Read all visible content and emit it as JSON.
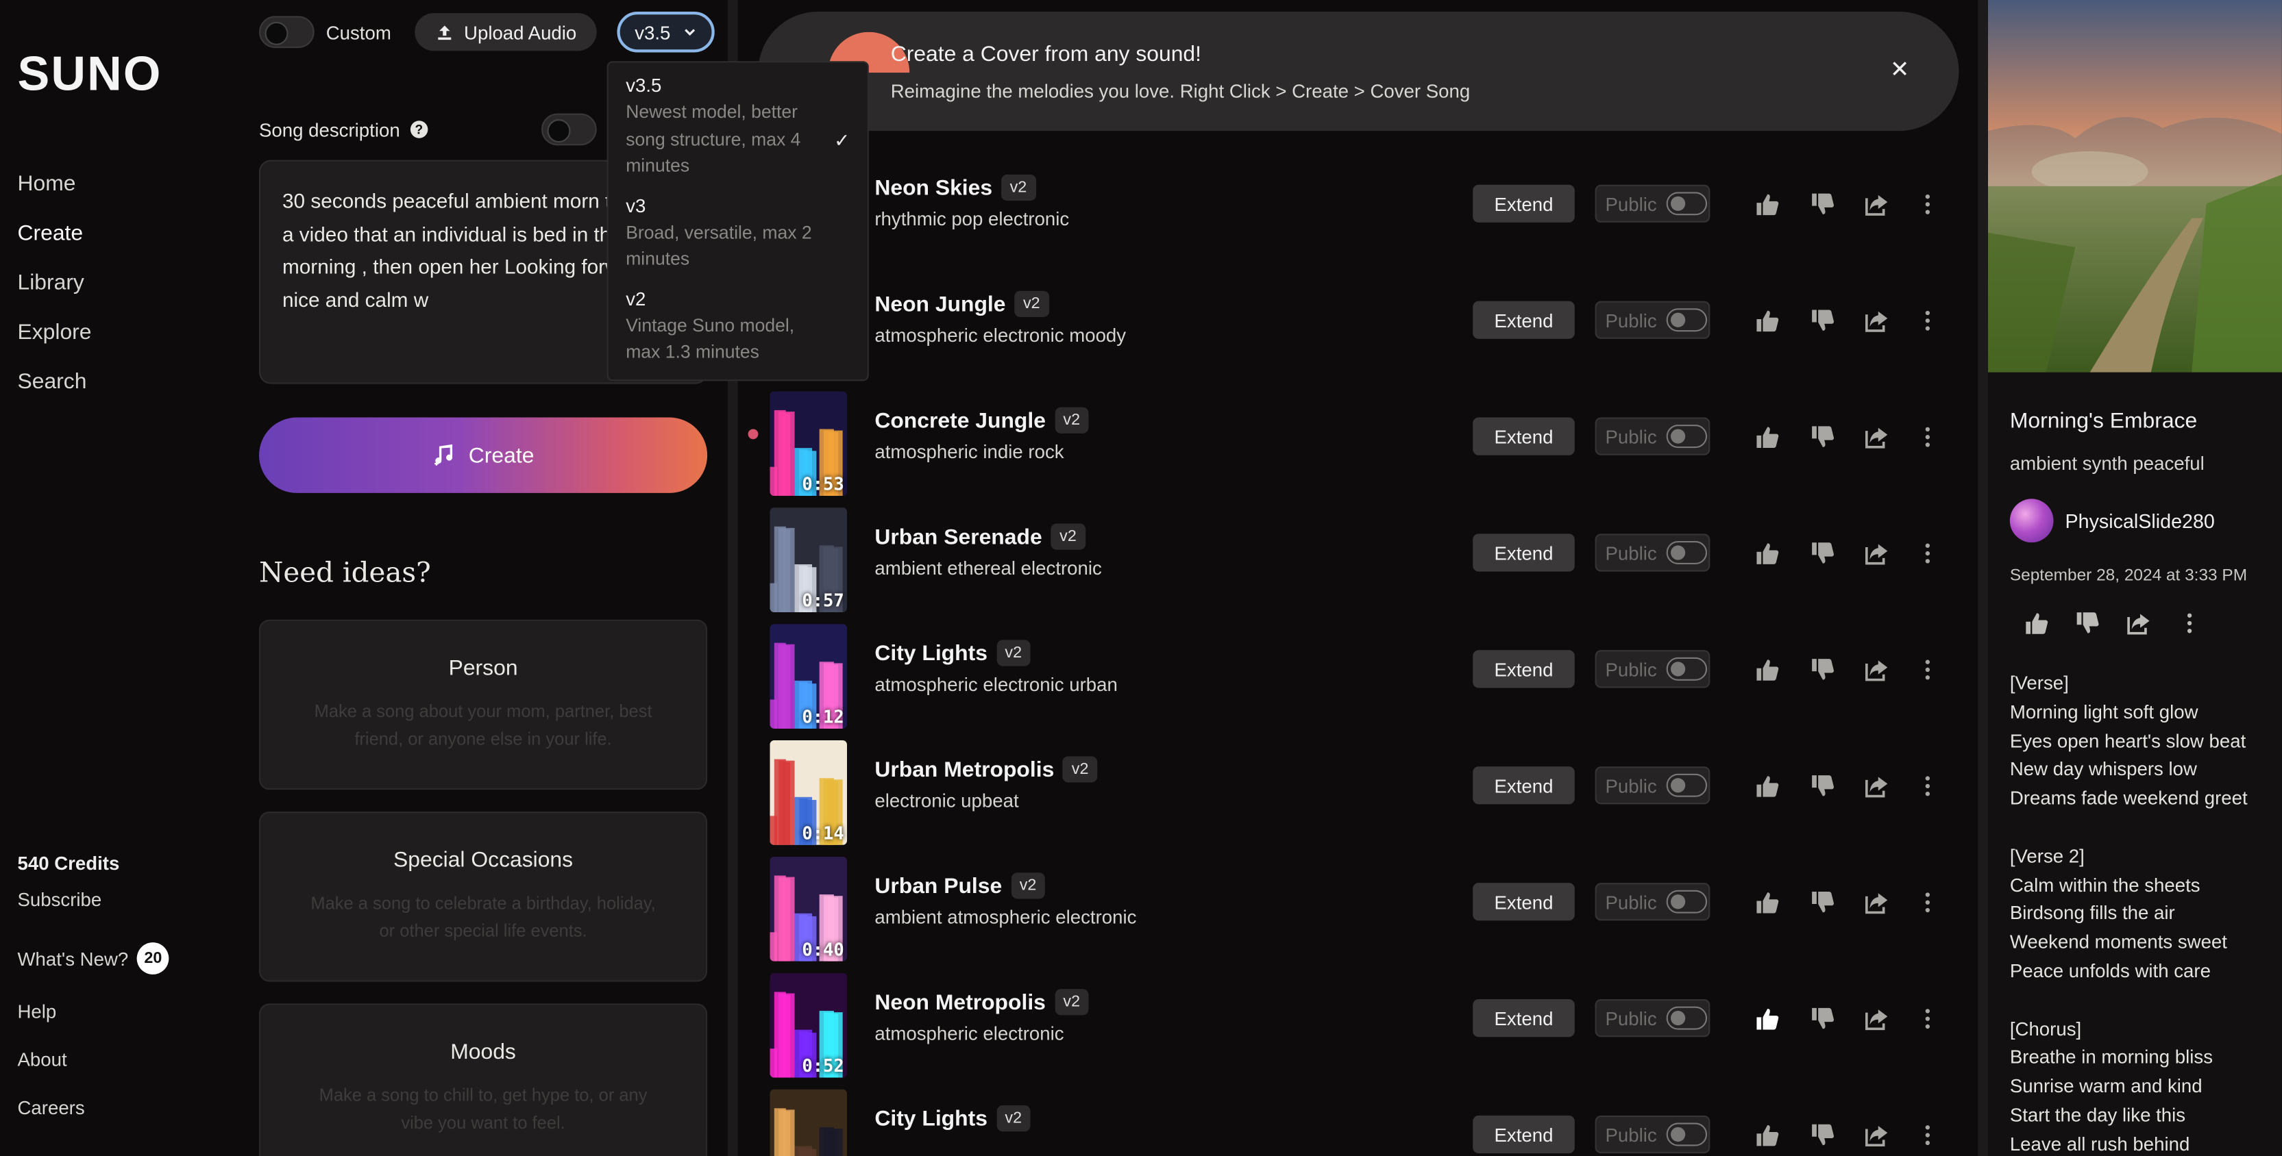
{
  "sidebar": {
    "logo": "SUNO",
    "nav": [
      "Home",
      "Create",
      "Library",
      "Explore",
      "Search"
    ],
    "credits": "540 Credits",
    "subscribe": "Subscribe",
    "whats_new": "What's New?",
    "whats_new_count": "20",
    "links": [
      "Help",
      "About",
      "Careers"
    ]
  },
  "create": {
    "custom_label": "Custom",
    "upload_label": "Upload Audio",
    "version": "v3.5",
    "desc_label": "Song description",
    "desc_text": "30 seconds peaceful ambient morn track for a video that an individual is bed in the morning , then open her Looking forward a  nice and calm w",
    "create_label": "Create",
    "ideas_title": "Need ideas?",
    "ideas": [
      {
        "title": "Person",
        "text": "Make a song about your mom, partner, best friend, or anyone else in your life."
      },
      {
        "title": "Special Occasions",
        "text": "Make a song to celebrate a birthday, holiday, or other special life events."
      },
      {
        "title": "Moods",
        "text": "Make a song to chill to, get hype to, or any vibe you want to feel."
      }
    ]
  },
  "dropdown": [
    {
      "title": "v3.5",
      "desc": "Newest model, better song structure, max 4 minutes",
      "selected": true
    },
    {
      "title": "v3",
      "desc": "Broad, versatile, max 2 minutes",
      "selected": false
    },
    {
      "title": "v2",
      "desc": "Vintage Suno model, max 1.3 minutes",
      "selected": false
    }
  ],
  "banner": {
    "title": "Create a Cover from any sound!",
    "subtitle": "Reimagine the melodies you love. Right Click > Create > Cover Song"
  },
  "labels": {
    "extend": "Extend",
    "public": "Public"
  },
  "songs": [
    {
      "title": "Neon Skies",
      "tag": "v2",
      "style": "rhythmic pop electronic",
      "duration": "",
      "liked": false
    },
    {
      "title": "Neon Jungle",
      "tag": "v2",
      "style": "atmospheric electronic moody",
      "duration": "",
      "liked": false
    },
    {
      "title": "Concrete Jungle",
      "tag": "v2",
      "style": "atmospheric indie rock",
      "duration": "0:53",
      "liked": false,
      "playing": true
    },
    {
      "title": "Urban Serenade",
      "tag": "v2",
      "style": "ambient ethereal electronic",
      "duration": "0:57",
      "liked": false
    },
    {
      "title": "City Lights",
      "tag": "v2",
      "style": "atmospheric electronic urban",
      "duration": "0:12",
      "liked": false
    },
    {
      "title": "Urban Metropolis",
      "tag": "v2",
      "style": "electronic upbeat",
      "duration": "0:14",
      "liked": false
    },
    {
      "title": "Urban Pulse",
      "tag": "v2",
      "style": "ambient atmospheric electronic",
      "duration": "0:40",
      "liked": false
    },
    {
      "title": "Neon Metropolis",
      "tag": "v2",
      "style": "atmospheric electronic",
      "duration": "0:52",
      "liked": true
    },
    {
      "title": "City Lights",
      "tag": "v2",
      "style": "",
      "duration": "",
      "liked": false
    }
  ],
  "detail": {
    "title": "Morning's Embrace",
    "style": "ambient synth peaceful",
    "user": "PhysicalSlide280",
    "date": "September 28, 2024 at 3:33 PM",
    "lyrics": "[Verse]\nMorning light soft glow\nEyes open heart's slow beat\nNew day whispers low\nDreams fade weekend greet\n\n[Verse 2]\nCalm within the sheets\nBirdsong fills the air\nWeekend moments sweet\nPeace unfolds with care\n\n[Chorus]\nBreathe in morning bliss\nSunrise warm and kind\nStart the day like this\nLeave all rush behind"
  }
}
